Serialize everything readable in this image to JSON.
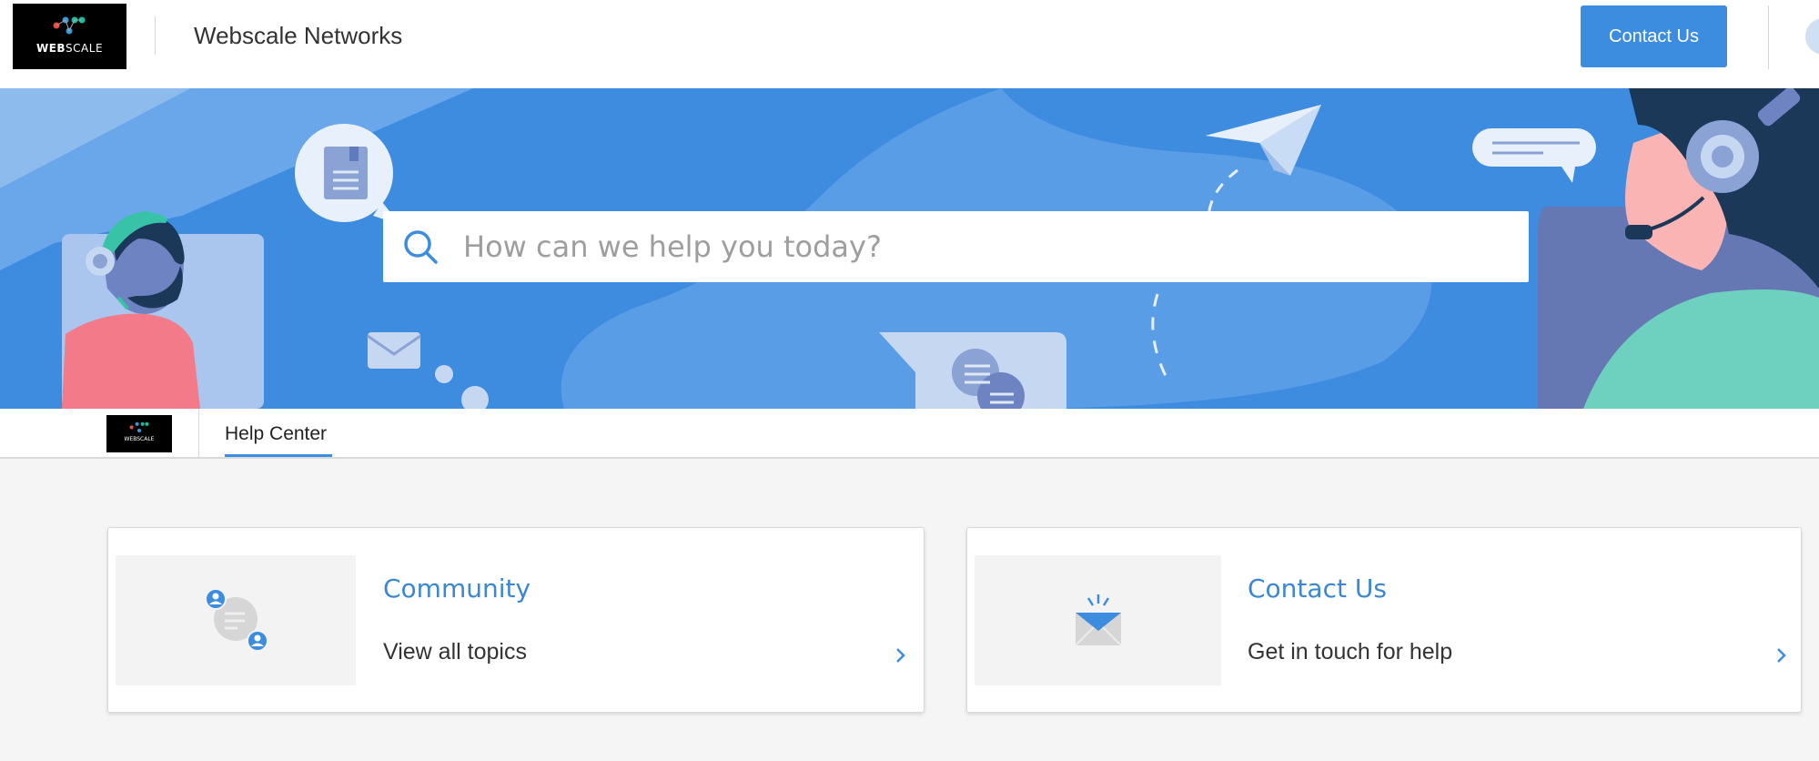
{
  "header": {
    "logo_text_bold": "WEB",
    "logo_text_rest": "SCALE",
    "site_name": "Webscale Networks",
    "contact_button": "Contact Us"
  },
  "hero": {
    "search_placeholder": "How can we help you today?"
  },
  "subnav": {
    "logo_text": "WEBSCALE",
    "tab_label": "Help Center"
  },
  "cards": [
    {
      "title": "Community",
      "description": "View all topics",
      "icon": "community-icon"
    },
    {
      "title": "Contact Us",
      "description": "Get in touch for help",
      "icon": "envelope-icon"
    }
  ],
  "colors": {
    "accent": "#3c8ce0",
    "hero_bg": "#3d8ce0",
    "link_title": "#3a87d6",
    "page_bg": "#f5f5f5"
  }
}
